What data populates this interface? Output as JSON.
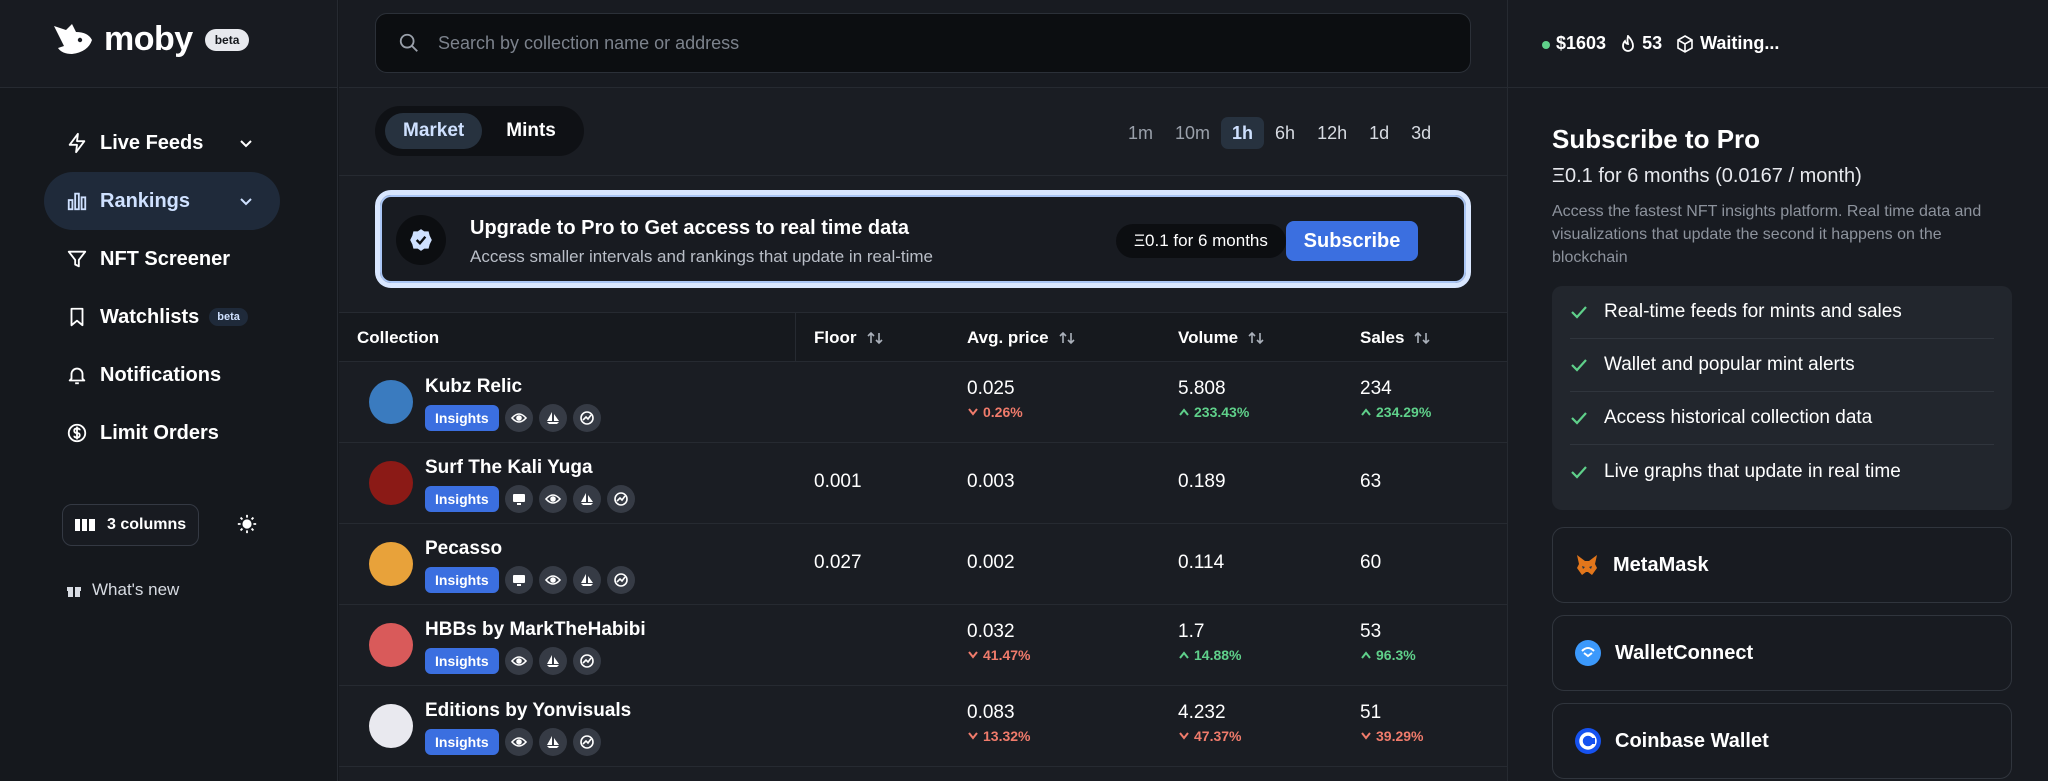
{
  "app": {
    "name": "moby",
    "badge": "beta"
  },
  "sidebar": {
    "items": [
      {
        "label": "Live Feeds",
        "icon": "bolt-icon",
        "chevron": true
      },
      {
        "label": "Rankings",
        "icon": "bar-chart-icon",
        "chevron": true,
        "active": true
      },
      {
        "label": "NFT Screener",
        "icon": "filter-icon"
      },
      {
        "label": "Watchlists",
        "icon": "bookmark-icon",
        "badge": "beta"
      },
      {
        "label": "Notifications",
        "icon": "bell-icon"
      },
      {
        "label": "Limit Orders",
        "icon": "dollar-circle-icon"
      }
    ],
    "columns_label": "3 columns",
    "whats_new": "What's new"
  },
  "search": {
    "placeholder": "Search by collection name or address"
  },
  "tabs": {
    "market": "Market",
    "mints": "Mints"
  },
  "ranges": [
    "1m",
    "10m",
    "1h",
    "6h",
    "12h",
    "1d",
    "3d"
  ],
  "upgrade": {
    "title": "Upgrade to Pro to Get access to real time data",
    "subtitle": "Access smaller intervals and rankings that update in real-time",
    "price": "Ξ0.1 for 6 months",
    "button": "Subscribe"
  },
  "table": {
    "headers": {
      "collection": "Collection",
      "floor": "Floor",
      "avg": "Avg. price",
      "volume": "Volume",
      "sales": "Sales"
    },
    "insights_label": "Insights",
    "rows": [
      {
        "name": "Kubz Relic",
        "floor": "",
        "avg": "0.025",
        "avg_chg": "0.26%",
        "avg_dir": "down",
        "volume": "5.808",
        "vol_chg": "233.43%",
        "vol_dir": "up",
        "sales": "234",
        "sales_chg": "234.29%",
        "sales_dir": "up",
        "color": "#3a7bbf"
      },
      {
        "name": "Surf The Kali Yuga",
        "floor": "0.001",
        "avg": "0.003",
        "avg_chg": "",
        "volume": "0.189",
        "vol_chg": "",
        "sales": "63",
        "sales_chg": "",
        "color": "#8b1a16"
      },
      {
        "name": "Pecasso",
        "floor": "0.027",
        "avg": "0.002",
        "avg_chg": "",
        "volume": "0.114",
        "vol_chg": "",
        "sales": "60",
        "sales_chg": "",
        "color": "#e8a23a"
      },
      {
        "name": "HBBs by MarkTheHabibi",
        "floor": "",
        "avg": "0.032",
        "avg_chg": "41.47%",
        "avg_dir": "down",
        "volume": "1.7",
        "vol_chg": "14.88%",
        "vol_dir": "up",
        "sales": "53",
        "sales_chg": "96.3%",
        "sales_dir": "up",
        "color": "#d95a5a"
      },
      {
        "name": "Editions by Yonvisuals",
        "floor": "",
        "avg": "0.083",
        "avg_chg": "13.32%",
        "avg_dir": "down",
        "volume": "4.232",
        "vol_chg": "47.37%",
        "vol_dir": "down",
        "sales": "51",
        "sales_chg": "39.29%",
        "sales_dir": "down",
        "color": "#e9e9ef"
      }
    ]
  },
  "stats": {
    "eth_price": "$1603",
    "gas": "53",
    "block": "Waiting..."
  },
  "pro": {
    "title": "Subscribe to Pro",
    "price": "Ξ0.1 for 6 months (0.0167 / month)",
    "description": "Access the fastest NFT insights platform. Real time data and visualizations that update the second it happens on the blockchain",
    "features": [
      "Real-time feeds for mints and sales",
      "Wallet and popular mint alerts",
      "Access historical collection data",
      "Live graphs that update in real time"
    ]
  },
  "wallets": [
    "MetaMask",
    "WalletConnect",
    "Coinbase Wallet"
  ],
  "colors": {
    "accent": "#3b6fe0",
    "up": "#5fd08a",
    "down": "#f07b6b",
    "active_nav": "#1f2a3a"
  }
}
